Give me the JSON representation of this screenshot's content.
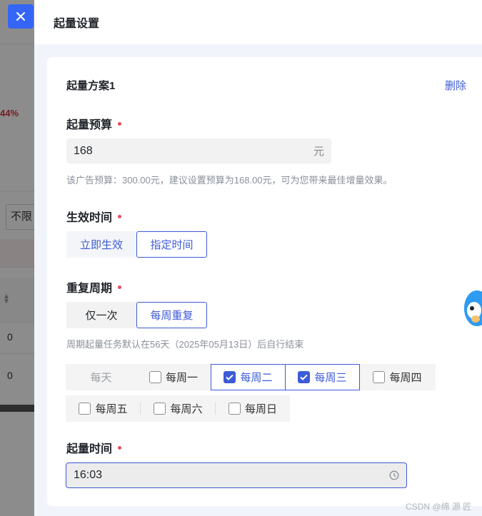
{
  "background": {
    "percent_text": "44%",
    "unlimit_text": "不限",
    "row_value_1": "0",
    "row_value_2": "0"
  },
  "drawer": {
    "title": "起量设置",
    "close_icon": "close-icon"
  },
  "plan": {
    "title": "起量方案1",
    "delete_label": "删除",
    "budget": {
      "label": "起量预算",
      "value": "168",
      "unit": "元",
      "hint": "该广告预算：300.00元，建议设置预算为168.00元，可为您带来最佳增量效果。"
    },
    "effective_time": {
      "label": "生效时间",
      "options": [
        "立即生效",
        "指定时间"
      ],
      "selected": "指定时间"
    },
    "repeat_cycle": {
      "label": "重复周期",
      "options": [
        "仅一次",
        "每周重复"
      ],
      "selected": "每周重复",
      "hint": "周期起量任务默认在56天（2025年05月13日）后自行结束",
      "weekdays_row1": [
        "每天",
        "每周一",
        "每周二",
        "每周三",
        "每周四"
      ],
      "weekdays_row2": [
        "每周五",
        "每周六",
        "每周日"
      ],
      "checked": [
        "每周二",
        "每周三"
      ]
    },
    "start_time": {
      "label": "起量时间",
      "value": "16:03",
      "icon": "clock-icon"
    }
  },
  "watermark": "CSDN @绵   源   匠",
  "colors": {
    "accent": "#3d5bd6",
    "required_dot": "#e34d59",
    "close_button": "#3565f6",
    "body_bg": "#f2f4fb"
  }
}
